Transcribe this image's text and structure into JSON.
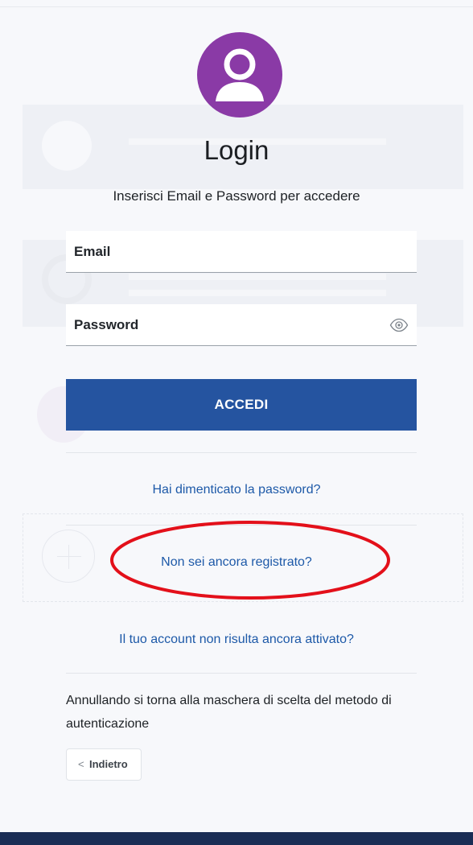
{
  "login": {
    "title": "Login",
    "subtitle": "Inserisci Email e Password per accedere",
    "email_label": "Email",
    "password_label": "Password",
    "submit_label": "ACCEDI",
    "forgot_password_link": "Hai dimenticato la password?",
    "register_link": "Non sei ancora registrato?",
    "not_activated_link": "Il tuo account non risulta ancora attivato?",
    "cancel_note": "Annullando si torna alla maschera di scelta del metodo di autenticazione",
    "back_label": "Indietro"
  },
  "icons": {
    "avatar": "user-avatar-icon",
    "password_toggle": "eye-icon",
    "back": "chevron-left-icon"
  },
  "colors": {
    "primary": "#2554a0",
    "avatar": "#8a3aa6",
    "link": "#1d59a8",
    "highlight": "#e3101a",
    "footer": "#1a2d55"
  }
}
